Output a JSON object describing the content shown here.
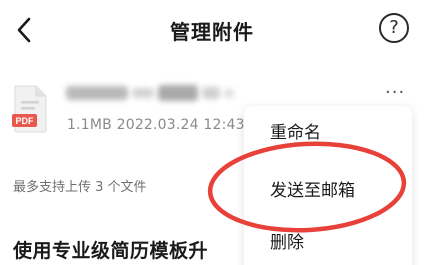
{
  "header": {
    "title": "管理附件",
    "back_icon": "chevron-left-icon",
    "help_label": "?"
  },
  "attachment": {
    "file_type": "PDF",
    "meta": "1.1MB 2022.03.24 12:43",
    "more_label": "···"
  },
  "limit_text": "最多支持上传 3 个文件",
  "promo_text": "使用专业级简历模板升",
  "menu": {
    "items": [
      {
        "label": "重命名"
      },
      {
        "label": "发送至邮箱"
      },
      {
        "label": "删除"
      }
    ]
  },
  "colors": {
    "pdf_badge": "#e8584f",
    "annotation_circle": "#e8413a"
  }
}
